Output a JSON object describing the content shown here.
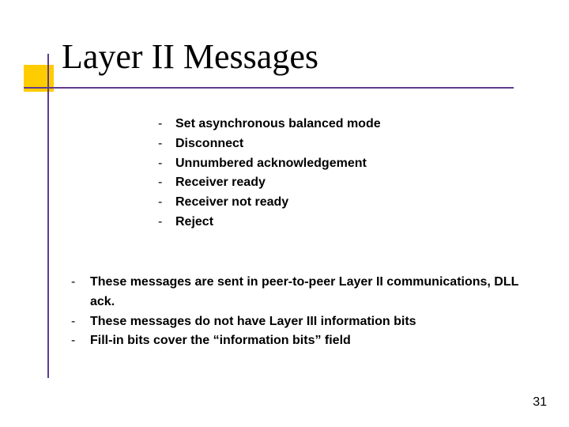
{
  "title": "Layer II Messages",
  "sub_items": [
    "Set asynchronous balanced mode",
    "Disconnect",
    "Unnumbered acknowledgement",
    "Receiver ready",
    "Receiver not ready",
    "Reject"
  ],
  "main_items": [
    "These messages are sent in peer-to-peer Layer II communications, DLL ack.",
    "These messages do not have Layer III information bits",
    "Fill-in bits cover the “information bits” field"
  ],
  "page_number": "31",
  "bullet_char": "-"
}
